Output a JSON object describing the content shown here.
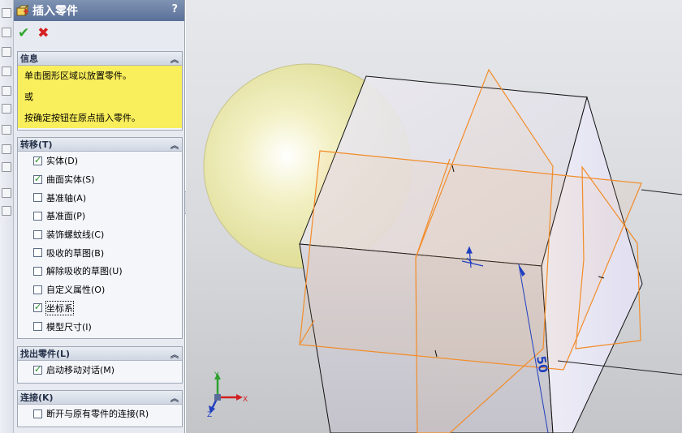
{
  "panel": {
    "title": "插入零件",
    "help_label": "?",
    "ok_icon": "✔",
    "cancel_icon": "✖"
  },
  "groups": {
    "info": {
      "title": "信息",
      "lines": [
        "单击图形区域以放置零件。",
        "或",
        "按确定按钮在原点插入零件。"
      ]
    },
    "transfer": {
      "title": "转移(T)",
      "options": [
        {
          "label": "实体(D)",
          "checked": true
        },
        {
          "label": "曲面实体(S)",
          "checked": true
        },
        {
          "label": "基准轴(A)",
          "checked": false
        },
        {
          "label": "基准面(P)",
          "checked": false
        },
        {
          "label": "装饰螺蚊线(C)",
          "checked": false
        },
        {
          "label": "吸收的草图(B)",
          "checked": false
        },
        {
          "label": "解除吸收的草图(U)",
          "checked": false
        },
        {
          "label": "自定义属性(O)",
          "checked": false
        },
        {
          "label": "坐标系",
          "checked": true
        },
        {
          "label": "模型尺寸(I)",
          "checked": false
        }
      ]
    },
    "locate": {
      "title": "找出零件(L)",
      "options": [
        {
          "label": "启动移动对话(M)",
          "checked": true
        }
      ]
    },
    "link": {
      "title": "连接(K)",
      "options": [
        {
          "label": "断开与原有零件的连接(R)",
          "checked": false
        }
      ]
    }
  },
  "viewport": {
    "dimension_text": "50",
    "triad": {
      "x": "X",
      "y": "Y",
      "z": "Z"
    }
  },
  "colors": {
    "title_bar": "#5b7098",
    "message_bg": "#f9ee5b",
    "plane_edges": "#f28c28",
    "dimension": "#1f3fbf",
    "sphere": "#eeeeb4"
  }
}
